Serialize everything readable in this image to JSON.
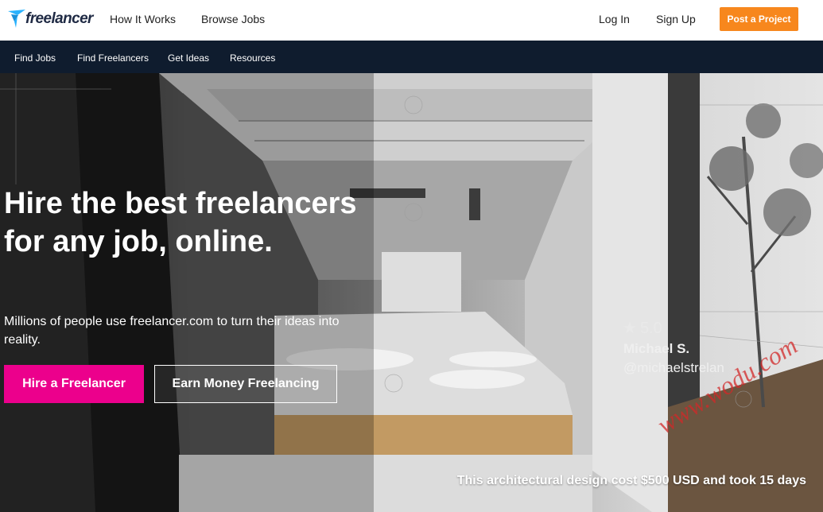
{
  "header": {
    "logo_text": "freelancer",
    "nav": [
      "How It Works",
      "Browse Jobs"
    ],
    "login_label": "Log In",
    "signup_label": "Sign Up",
    "post_project_label": "Post a Project",
    "accent_color": "#f7871d"
  },
  "subnav": {
    "items": [
      "Find Jobs",
      "Find Freelancers",
      "Get Ideas",
      "Resources"
    ]
  },
  "hero": {
    "title": "Hire the best freelancers for any job, online.",
    "subtitle": "Millions of people use freelancer.com to turn their ideas into reality.",
    "hire_button": "Hire a Freelancer",
    "earn_button": "Earn Money Freelancing",
    "rating": "5.0",
    "designer_name": "Michael S.",
    "designer_handle": "@michaelstrelan",
    "caption": "This architectural design cost $500 USD and took 15 days",
    "watermark": "www.wodu.com",
    "hire_color": "#ec008c"
  }
}
